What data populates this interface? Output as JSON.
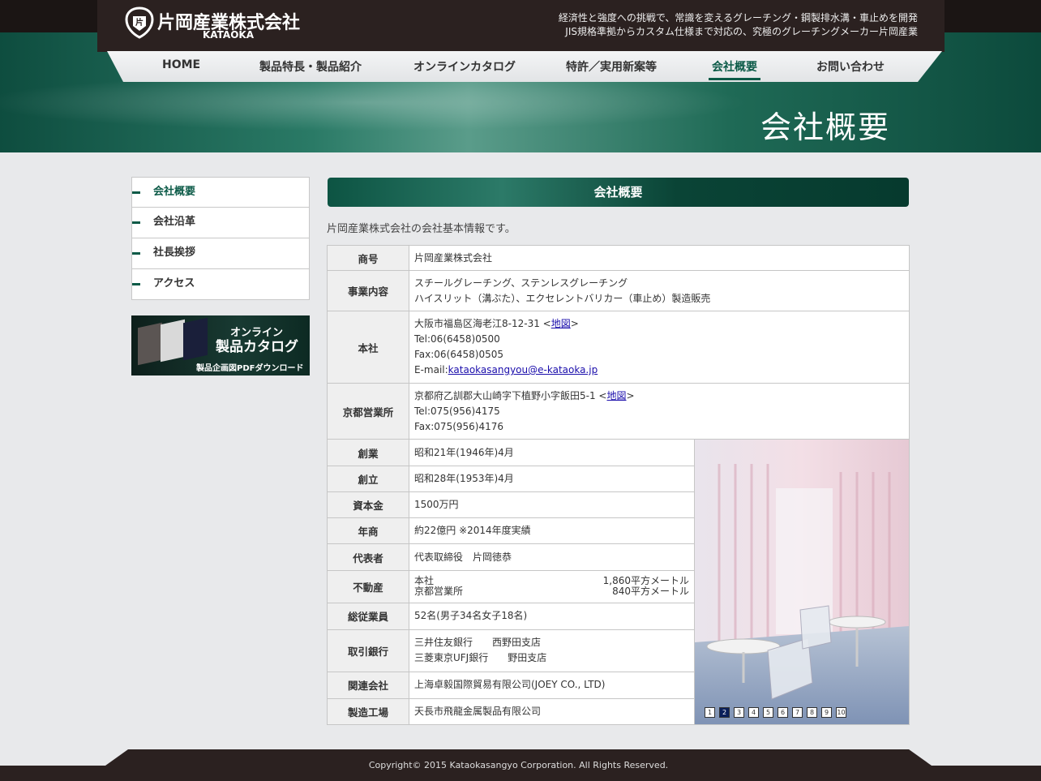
{
  "header": {
    "logo_text": "片岡産業株式会社",
    "logo_sub": "KATAOKA",
    "tagline": [
      "経済性と強度への挑戦で、常識を変えるグレーチング・鋼製排水溝・車止めを開発",
      "JIS規格準拠からカスタム仕様まで対応の、究極のグレーチングメーカー片岡産業"
    ]
  },
  "nav": [
    {
      "label": "HOME",
      "active": false
    },
    {
      "label": "製品特長・製品紹介",
      "active": false
    },
    {
      "label": "オンラインカタログ",
      "active": false
    },
    {
      "label": "特許／実用新案等",
      "active": false
    },
    {
      "label": "会社概要",
      "active": true
    },
    {
      "label": "お問い合わせ",
      "active": false
    }
  ],
  "page_title": "会社概要",
  "sidebar": {
    "items": [
      {
        "label": "会社概要",
        "active": true
      },
      {
        "label": "会社沿革",
        "active": false
      },
      {
        "label": "社長挨拶",
        "active": false
      },
      {
        "label": "アクセス",
        "active": false
      }
    ],
    "catalog_banner": {
      "line1": "オンライン",
      "line2": "製品カタログ",
      "line3": "製品企画図PDFダウンロード"
    }
  },
  "main": {
    "section_title": "会社概要",
    "intro": "片岡産業株式会社の会社基本情報です。",
    "rows": {
      "shogo": {
        "label": "商号",
        "value": "片岡産業株式会社"
      },
      "jigyo": {
        "label": "事業内容",
        "line1": "スチールグレーチング、ステンレスグレーチング",
        "line2": "ハイスリット（溝ぶた）、エクセレントバリカー（車止め）製造販売"
      },
      "honsha": {
        "label": "本社",
        "address": "大阪市福島区海老江8-12-31 <",
        "map": "地図",
        "address_end": ">",
        "tel": "Tel:06(6458)0500",
        "fax": "Fax:06(6458)0505",
        "email_label": "E-mail:",
        "email": "kataokasangyou@e-kataoka.jp"
      },
      "kyoto": {
        "label": "京都営業所",
        "address": "京都府乙訓郡大山崎字下植野小字飯田5-1 <",
        "map": "地図",
        "address_end": ">",
        "tel": "Tel:075(956)4175",
        "fax": "Fax:075(956)4176"
      },
      "soguo": {
        "label": "創業",
        "value": "昭和21年(1946年)4月"
      },
      "soritsu": {
        "label": "創立",
        "value": "昭和28年(1953年)4月"
      },
      "shihon": {
        "label": "資本金",
        "value": "1500万円"
      },
      "nensho": {
        "label": "年商",
        "value": "約22億円 ※2014年度実績"
      },
      "daihyo": {
        "label": "代表者",
        "value": "代表取締役　片岡徳恭"
      },
      "fudosan": {
        "label": "不動産",
        "l1": "本社",
        "r1": "1,860平方メートル",
        "l2": "京都営業所",
        "r2": "840平方メートル"
      },
      "jugyoin": {
        "label": "総従業員",
        "value": "52名(男子34名女子18名)"
      },
      "ginko": {
        "label": "取引銀行",
        "line1": "三井住友銀行　　西野田支店",
        "line2": "三菱東京UFJ銀行　　野田支店"
      },
      "kanren": {
        "label": "関連会社",
        "value": "上海卓毅国際貿易有限公司(JOEY CO., LTD)"
      },
      "kojo": {
        "label": "製造工場",
        "value": "天長市飛龍金属製品有限公司"
      }
    },
    "slideshow": {
      "pages": [
        "1",
        "2",
        "3",
        "4",
        "5",
        "6",
        "7",
        "8",
        "9",
        "10"
      ],
      "active_page": "2"
    }
  },
  "footer": {
    "copyright": "Copyright© 2015 Kataokasangyo Corporation. All Rights Reserved."
  }
}
